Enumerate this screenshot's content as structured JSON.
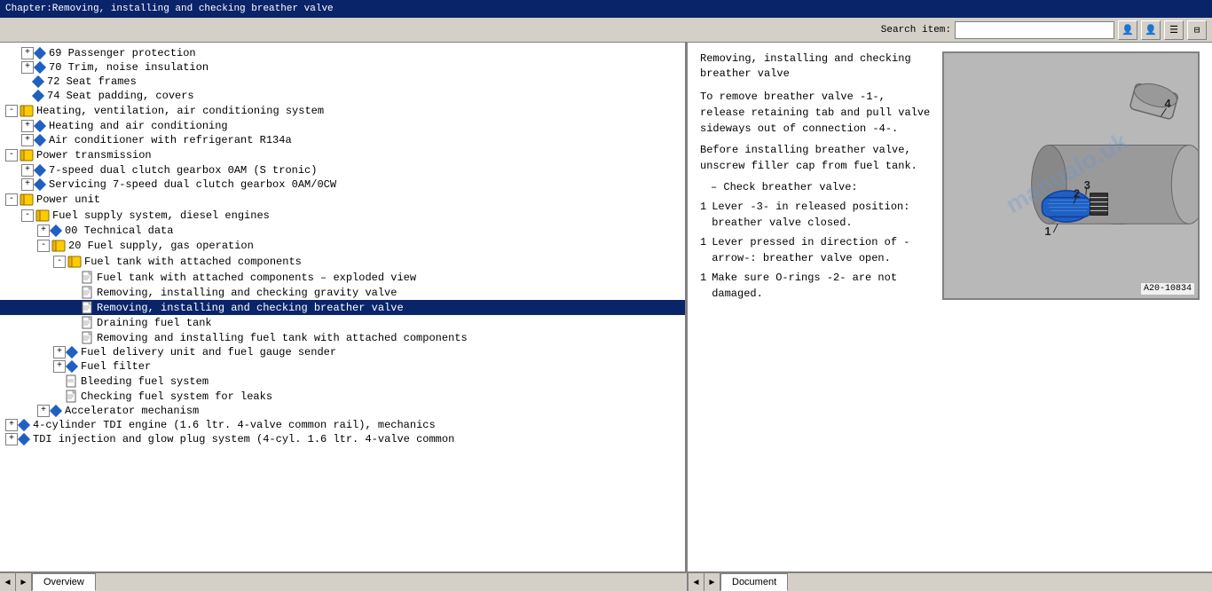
{
  "titleBar": {
    "text": "Chapter:Removing, installing and checking breather valve"
  },
  "toolbar": {
    "searchLabel": "Search item:",
    "searchPlaceholder": ""
  },
  "tree": {
    "items": [
      {
        "id": 1,
        "indent": 1,
        "type": "diamond-expand",
        "text": "69 Passenger protection",
        "level": 2
      },
      {
        "id": 2,
        "indent": 1,
        "type": "diamond-expand",
        "text": "70 Trim, noise insulation",
        "level": 2
      },
      {
        "id": 3,
        "indent": 1,
        "type": "diamond",
        "text": "72 Seat frames",
        "level": 2
      },
      {
        "id": 4,
        "indent": 1,
        "type": "diamond",
        "text": "74 Seat padding, covers",
        "level": 2
      },
      {
        "id": 5,
        "indent": 0,
        "type": "book-expand",
        "text": "Heating, ventilation, air conditioning system",
        "level": 1
      },
      {
        "id": 6,
        "indent": 1,
        "type": "diamond-expand",
        "text": "Heating and air conditioning",
        "level": 2
      },
      {
        "id": 7,
        "indent": 1,
        "type": "diamond-expand",
        "text": "Air conditioner with refrigerant R134a",
        "level": 2
      },
      {
        "id": 8,
        "indent": 0,
        "type": "book-expand",
        "text": "Power transmission",
        "level": 1
      },
      {
        "id": 9,
        "indent": 1,
        "type": "diamond-expand",
        "text": "7-speed dual clutch gearbox 0AM (S tronic)",
        "level": 2
      },
      {
        "id": 10,
        "indent": 1,
        "type": "diamond-expand",
        "text": "Servicing 7-speed dual clutch gearbox 0AM/0CW",
        "level": 2
      },
      {
        "id": 11,
        "indent": 0,
        "type": "book-expand",
        "text": "Power unit",
        "level": 1
      },
      {
        "id": 12,
        "indent": 1,
        "type": "book-expand",
        "text": "Fuel supply system, diesel engines",
        "level": 2
      },
      {
        "id": 13,
        "indent": 2,
        "type": "diamond-expand",
        "text": "00 Technical data",
        "level": 3
      },
      {
        "id": 14,
        "indent": 2,
        "type": "book-expand",
        "text": "20 Fuel supply, gas operation",
        "level": 3
      },
      {
        "id": 15,
        "indent": 3,
        "type": "book-expand",
        "text": "Fuel tank with attached components",
        "level": 4
      },
      {
        "id": 16,
        "indent": 4,
        "type": "doc",
        "text": "Fuel tank with attached components – exploded view",
        "level": 5
      },
      {
        "id": 17,
        "indent": 4,
        "type": "doc",
        "text": "Removing, installing and checking gravity valve",
        "level": 5
      },
      {
        "id": 18,
        "indent": 4,
        "type": "doc",
        "text": "Removing, installing and checking breather valve",
        "level": 5,
        "selected": true
      },
      {
        "id": 19,
        "indent": 4,
        "type": "doc",
        "text": "Draining fuel tank",
        "level": 5
      },
      {
        "id": 20,
        "indent": 4,
        "type": "doc",
        "text": "Removing and installing fuel tank with attached components",
        "level": 5
      },
      {
        "id": 21,
        "indent": 3,
        "type": "diamond-expand",
        "text": "Fuel delivery unit and fuel gauge sender",
        "level": 4
      },
      {
        "id": 22,
        "indent": 3,
        "type": "diamond-expand",
        "text": "Fuel filter",
        "level": 4
      },
      {
        "id": 23,
        "indent": 3,
        "type": "plain",
        "text": "Bleeding fuel system",
        "level": 4
      },
      {
        "id": 24,
        "indent": 3,
        "type": "doc",
        "text": "Checking fuel system for leaks",
        "level": 4
      },
      {
        "id": 25,
        "indent": 2,
        "type": "diamond-expand",
        "text": "Accelerator mechanism",
        "level": 3
      },
      {
        "id": 26,
        "indent": 0,
        "type": "diamond-expand",
        "text": "4-cylinder TDI engine (1.6 ltr. 4-valve common rail), mechanics",
        "level": 1
      },
      {
        "id": 27,
        "indent": 0,
        "type": "diamond-expand",
        "text": "TDI injection and glow plug system (4-cyl. 1.6 ltr. 4-valve common",
        "level": 1
      }
    ]
  },
  "rightPanel": {
    "title": "Removing, installing and\nchecking breather valve",
    "paragraphs": [
      {
        "type": "text",
        "content": "To remove breather valve -1-, release retaining tab and pull valve sideways out of connection -4-."
      },
      {
        "type": "text",
        "content": "Before installing breather valve, unscrew filler cap from fuel tank."
      },
      {
        "type": "dash",
        "content": "Check breather valve:"
      },
      {
        "type": "numbered",
        "num": "1",
        "content": "Lever -3- in released position: breather valve closed."
      },
      {
        "type": "numbered",
        "num": "1",
        "content": "Lever pressed in direction of -arrow-: breather valve open."
      },
      {
        "type": "numbered",
        "num": "1",
        "content": "Make sure O-rings -2- are not damaged."
      }
    ],
    "image": {
      "label": "A20-10834",
      "watermark": "manualo.uk"
    }
  },
  "statusBar": {
    "leftTab": "Overview",
    "rightTab": "Document",
    "navLeft1": "◄",
    "navLeft2": "►",
    "navRight1": "◄",
    "navRight2": "►"
  }
}
